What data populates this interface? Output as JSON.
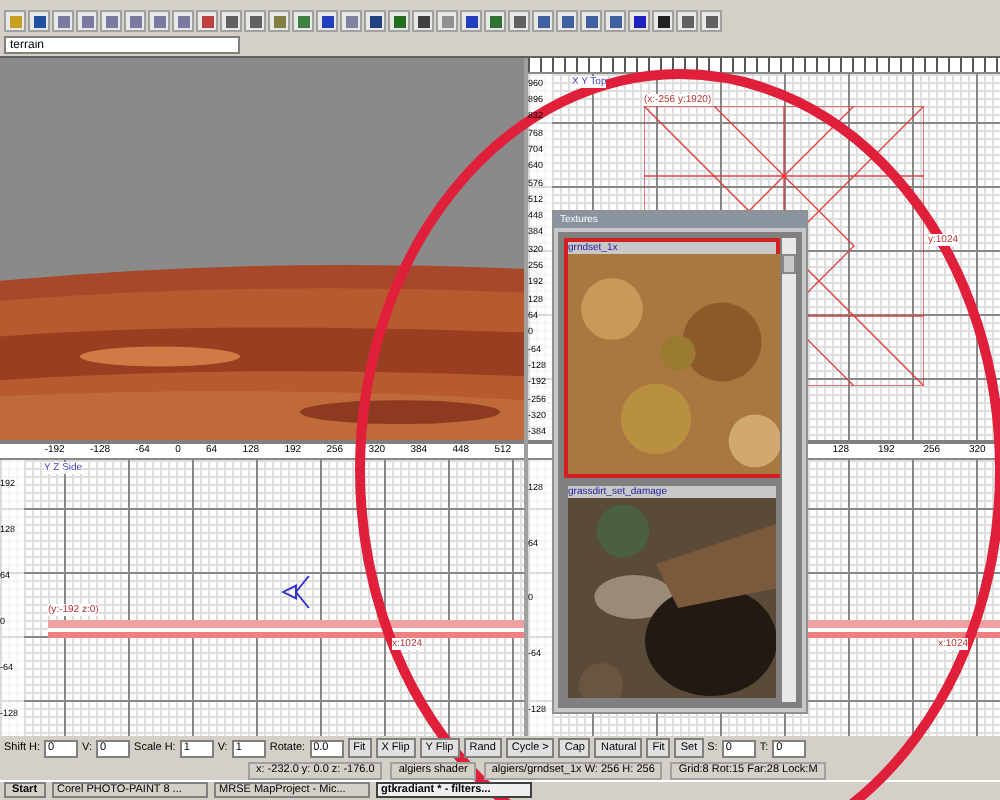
{
  "texture_filter": {
    "value": "terrain"
  },
  "camera_view": {
    "kind": "picture"
  },
  "top_view": {
    "label": "X Y Top",
    "y_ticks": [
      "960",
      "896",
      "832",
      "768",
      "704",
      "640",
      "576",
      "512",
      "448",
      "384",
      "320",
      "256",
      "192",
      "128",
      "64",
      "0",
      "-64",
      "-128",
      "-192",
      "-256",
      "-320",
      "-384"
    ],
    "brush_labels": [
      "(x:-256 y:1920)",
      "y:1024"
    ]
  },
  "side_view": {
    "label": "Y Z Side",
    "x_ticks": [
      "-192",
      "-128",
      "-64",
      "0",
      "64",
      "128",
      "192",
      "256",
      "320",
      "384",
      "448",
      "512"
    ],
    "y_ticks": [
      "192",
      "128",
      "64",
      "0",
      "-64",
      "-128"
    ],
    "brush_labels": [
      "(y:-192 z:0)",
      "x:1024"
    ]
  },
  "front_view": {
    "x_ticks": [
      "128",
      "192",
      "256",
      "320"
    ],
    "y_ticks": [
      "128",
      "64",
      "0",
      "-64",
      "-128"
    ],
    "brush_labels": [
      "x:1024"
    ]
  },
  "textures_window": {
    "title": "Textures",
    "items": [
      {
        "name": "grndset_1x",
        "selected": true
      },
      {
        "name": "grassdirt_set_damage",
        "selected": false
      }
    ]
  },
  "surface_bar": [
    {
      "kind": "label",
      "text": "Shift H:"
    },
    {
      "kind": "spin",
      "value": "0"
    },
    {
      "kind": "label",
      "text": "V:"
    },
    {
      "kind": "spin",
      "value": "0"
    },
    {
      "kind": "label",
      "text": "Scale H:"
    },
    {
      "kind": "spin",
      "value": "1"
    },
    {
      "kind": "label",
      "text": "V:"
    },
    {
      "kind": "spin",
      "value": "1"
    },
    {
      "kind": "label",
      "text": "Rotate:"
    },
    {
      "kind": "spin",
      "value": "0.0"
    },
    {
      "kind": "button",
      "text": "Fit"
    },
    {
      "kind": "button",
      "text": "X Flip"
    },
    {
      "kind": "button",
      "text": "Y Flip"
    },
    {
      "kind": "button",
      "text": "Rand"
    },
    {
      "kind": "button",
      "text": "Cycle >"
    },
    {
      "kind": "button",
      "text": "Cap"
    },
    {
      "kind": "button",
      "text": "Natural"
    },
    {
      "kind": "button",
      "text": "Fit"
    },
    {
      "kind": "button",
      "text": "Set"
    },
    {
      "kind": "label",
      "text": "S:"
    },
    {
      "kind": "spin",
      "value": "0"
    },
    {
      "kind": "label",
      "text": "T:"
    },
    {
      "kind": "spin",
      "value": "0"
    }
  ],
  "status_bar": [
    "x: -232.0  y: 0.0  z: -176.0",
    "algiers shader",
    "algiers/grndset_1x W: 256 H: 256",
    "Grid:8 Rot:15 Far:28 Lock:M"
  ],
  "taskbar": {
    "start": "Start",
    "tasks": [
      {
        "label": "Corel PHOTO-PAINT 8 ...",
        "selected": false
      },
      {
        "label": "MRSE MapProject - Mic...",
        "selected": false
      },
      {
        "label": "gtkradiant * - filters...",
        "selected": true
      }
    ]
  }
}
